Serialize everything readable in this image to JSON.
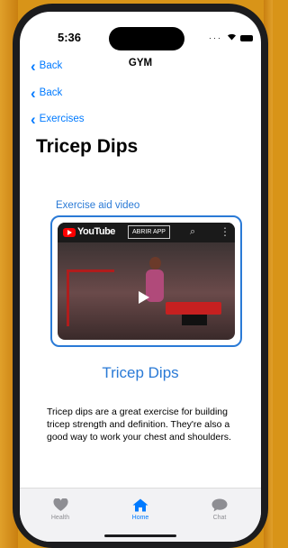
{
  "status_bar": {
    "time": "5:36"
  },
  "nav": {
    "back_1": "Back",
    "title": "GYM",
    "back_2": "Back",
    "back_3": "Exercises"
  },
  "page": {
    "title": "Tricep Dips",
    "aid_link": "Exercise aid video",
    "video": {
      "brand": "YouTube",
      "open_app": "ABRIR APP"
    },
    "exercise_name": "Tricep Dips",
    "description": "Tricep dips are a great exercise for building tricep strength and definition. They're also a good way to work your chest and shoulders."
  },
  "tabbar": {
    "items": [
      {
        "label": "Health",
        "icon": "heart-icon"
      },
      {
        "label": "Home",
        "icon": "home-icon",
        "active": true
      },
      {
        "label": "Chat",
        "icon": "chat-bubble-icon"
      }
    ]
  },
  "colors": {
    "accent": "#007aff",
    "link": "#2a7ad6",
    "video_border": "#2a7ad6",
    "background": "#d89418"
  }
}
